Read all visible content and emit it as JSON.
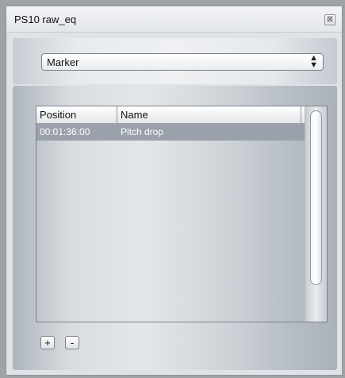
{
  "window": {
    "title": "PS10 raw_eq",
    "close_glyph": "⊠"
  },
  "type_select": {
    "value": "Marker"
  },
  "table": {
    "columns": [
      "Position",
      "Name"
    ],
    "rows": [
      {
        "position": "00:01:36:00",
        "name": "Pitch drop",
        "selected": true
      }
    ]
  },
  "buttons": {
    "add": "+",
    "remove": "-"
  },
  "icons": {
    "close": "close-icon",
    "select_arrows": "up-down-arrows-icon"
  }
}
